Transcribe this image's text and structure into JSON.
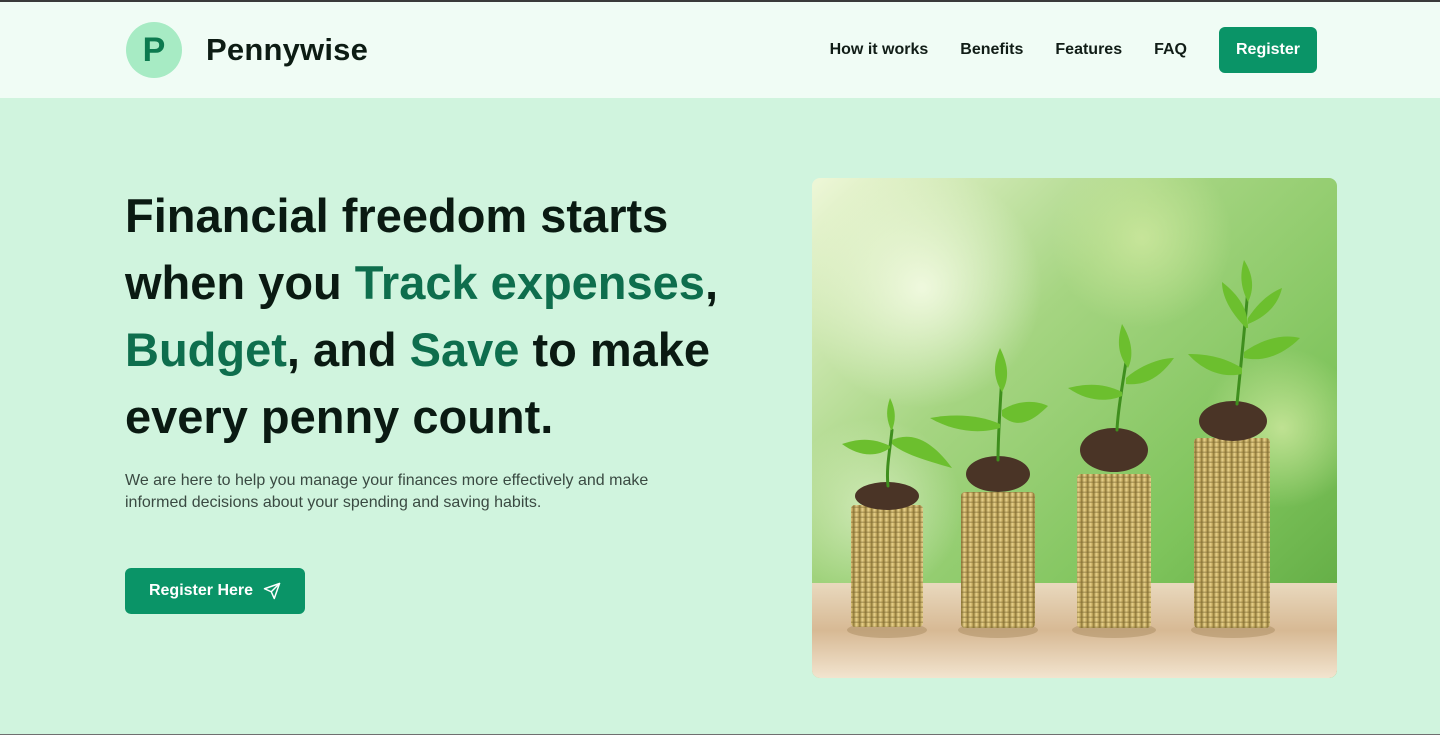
{
  "brand": {
    "initial": "P",
    "name": "Pennywise"
  },
  "nav": {
    "links": [
      "How it works",
      "Benefits",
      "Features",
      "FAQ"
    ],
    "register_label": "Register"
  },
  "hero": {
    "title_1": "Financial freedom starts when you ",
    "accent_1": "Track expenses",
    "title_2": ", ",
    "accent_2": "Budget",
    "title_3": ", and ",
    "accent_3": "Save",
    "title_4": " to make every penny count.",
    "subtitle": "We are here to help you manage your finances more effectively and make informed decisions about your spending and saving habits.",
    "cta_label": "Register Here",
    "cta_icon": "send-icon",
    "image": "coin-stacks-with-plants"
  },
  "colors": {
    "brand_green": "#0a9467",
    "accent_text": "#0e6e4d",
    "hero_bg": "#d0f4de",
    "header_bg": "#f0fcf5"
  }
}
